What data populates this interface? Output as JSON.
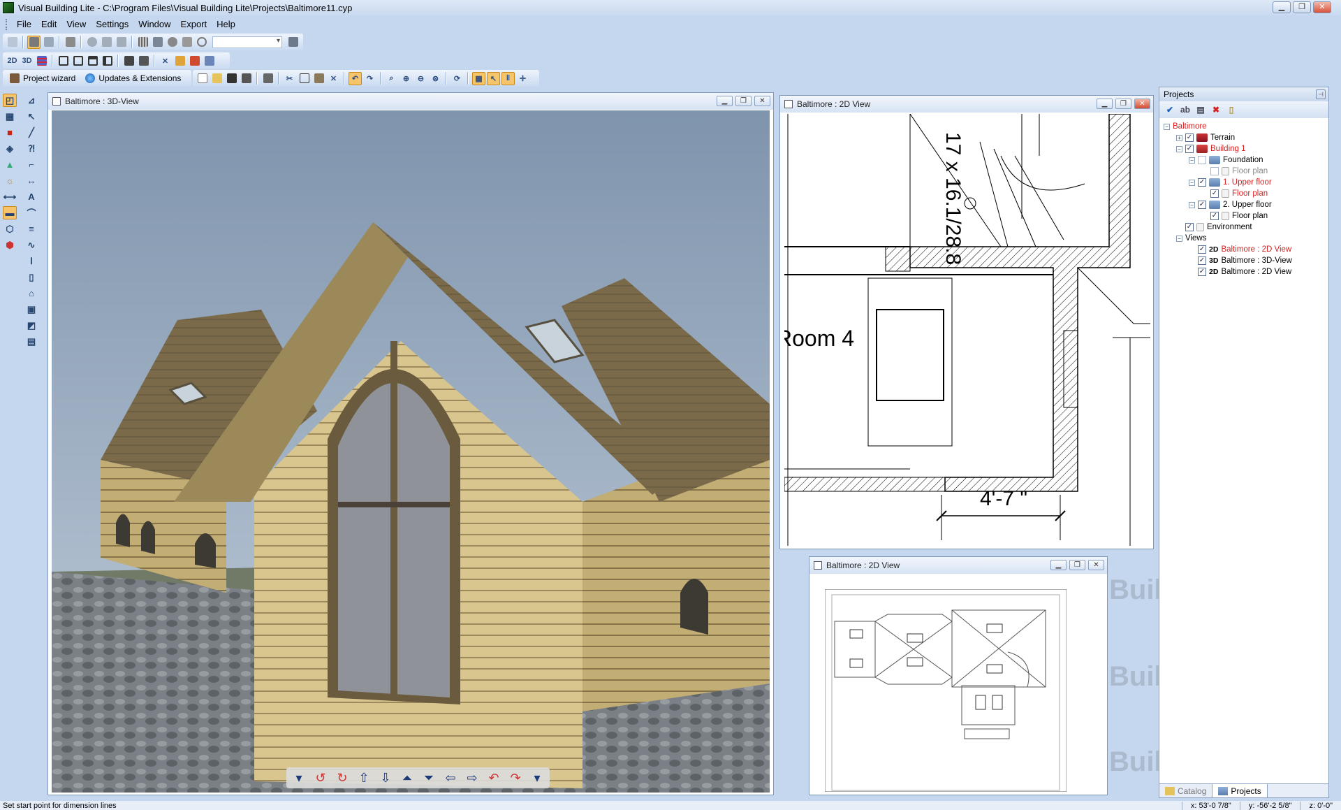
{
  "app": {
    "title": "Visual Building Lite - C:\\Program Files\\Visual Building Lite\\Projects\\Baltimore11.cyp"
  },
  "window_controls": {
    "minimize": "▁",
    "restore": "❐",
    "close": "✕"
  },
  "menu": [
    "File",
    "Edit",
    "View",
    "Settings",
    "Window",
    "Export",
    "Help"
  ],
  "toolbar_row2": {
    "btn_2d": "2D",
    "btn_3d": "3D"
  },
  "toolbar_row3": {
    "project_wizard": "Project wizard",
    "updates": "Updates & Extensions"
  },
  "windows": {
    "view3d": {
      "title": "Baltimore : 3D-View"
    },
    "view2d_top": {
      "title": "Baltimore : 2D View",
      "stairs_label": "17 x 16.1/28.8",
      "room_label": "Room 4",
      "room_label_visible": "Room 4",
      "dimension": "4'-7 \""
    },
    "view2d_bottom": {
      "title": "Baltimore : 2D View"
    }
  },
  "projects_panel": {
    "title": "Projects",
    "tree": [
      {
        "label": "Baltimore",
        "level": 0,
        "expanded": true,
        "color": "red"
      },
      {
        "label": "Terrain",
        "level": 1,
        "checked": true
      },
      {
        "label": "Building 1",
        "level": 1,
        "checked": true,
        "color": "red"
      },
      {
        "label": "Foundation",
        "level": 2,
        "checked": false
      },
      {
        "label": "Floor plan",
        "level": 3,
        "checked": false,
        "dim": true
      },
      {
        "label": "1. Upper floor",
        "level": 2,
        "checked": true,
        "color": "red"
      },
      {
        "label": "Floor plan",
        "level": 3,
        "checked": true,
        "color": "red"
      },
      {
        "label": "2. Upper floor",
        "level": 2,
        "checked": true
      },
      {
        "label": "Floor plan",
        "level": 3,
        "checked": true
      },
      {
        "label": "Environment",
        "level": 1,
        "checked": true
      },
      {
        "label": "Views",
        "level": 0,
        "expanded": true
      },
      {
        "label": "Baltimore : 2D View",
        "level": 1,
        "tag": "2D",
        "checked": true,
        "color": "red"
      },
      {
        "label": "Baltimore : 3D-View",
        "level": 1,
        "tag": "3D",
        "checked": true
      },
      {
        "label": "Baltimore : 2D View",
        "level": 1,
        "tag": "2D",
        "checked": true
      }
    ],
    "tabs": {
      "catalog": "Catalog",
      "projects": "Projects"
    }
  },
  "status": {
    "message": "Set start point for dimension lines",
    "x": "x: 53'-0 7/8\"",
    "y": "y: -56'-2 5/8\"",
    "z": "z: 0'-0\""
  },
  "watermark": "Build",
  "colors": {
    "accent_red": "#d42020",
    "active_tool": "#f6c46a"
  }
}
